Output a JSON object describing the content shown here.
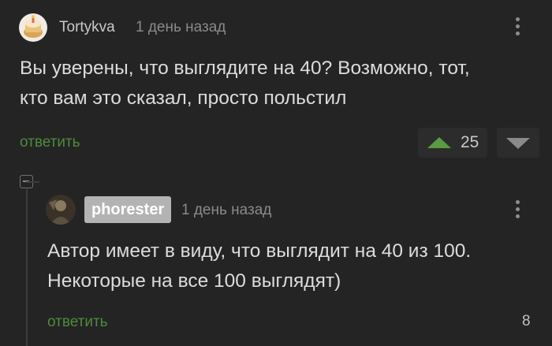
{
  "comments": [
    {
      "author": "Tortykva",
      "time": "1 день назад",
      "text_line1": "Вы уверены, что выглядите на 40? Возможно, тот,",
      "text_line2": "кто вам это сказал, просто польстил",
      "reply_label": "ответить",
      "rating": "25"
    },
    {
      "author": "phorester",
      "time": "1 день назад",
      "text_line1": "Автор имеет в виду, что выглядит на 40 из 100.",
      "text_line2": "Некоторые на все 100 выглядят)",
      "reply_label": "ответить",
      "rating": "8"
    }
  ],
  "icons": {
    "menu": "more-vertical-icon",
    "upvote": "upvote-triangle-icon",
    "downvote": "downvote-triangle-icon",
    "collapse": "collapse-minus-icon"
  },
  "colors": {
    "background": "#242424",
    "link": "#4f8a3d",
    "upvote": "#5a9a43",
    "badge": "#b3b3b3"
  }
}
